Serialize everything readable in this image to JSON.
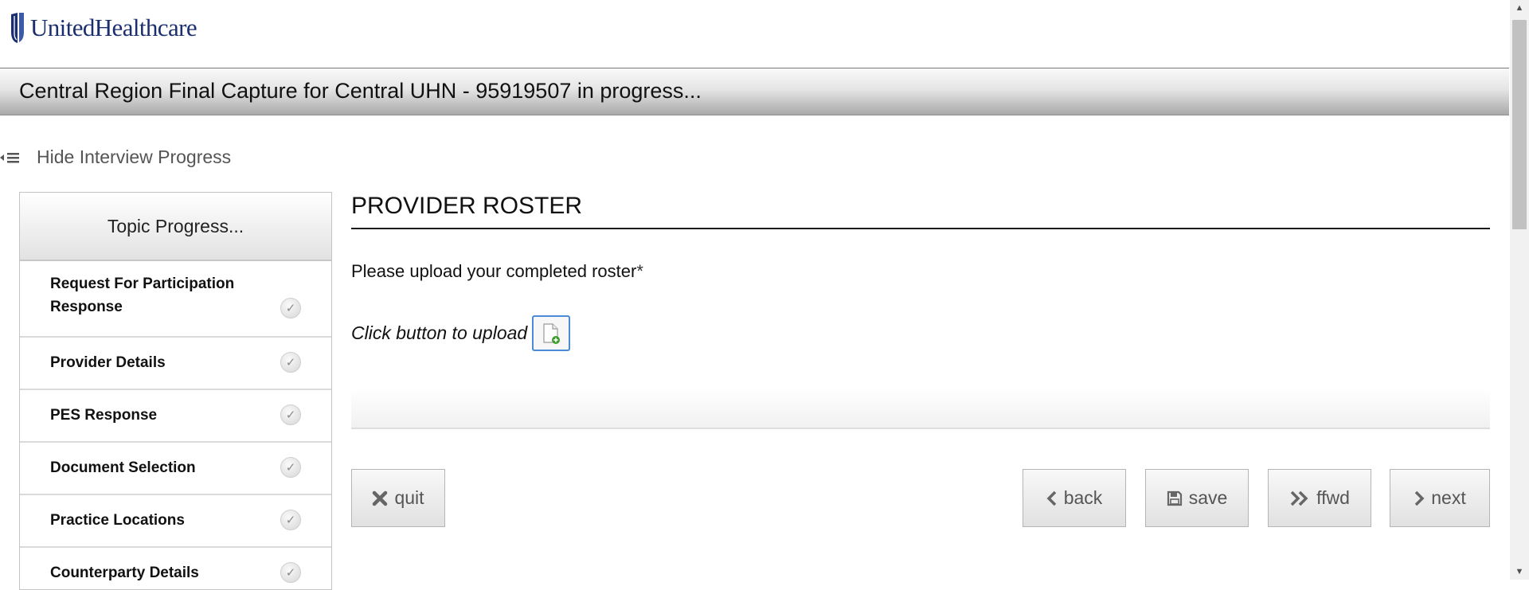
{
  "brand": {
    "name": "UnitedHealthcare"
  },
  "header": {
    "title": "Central Region Final Capture for Central UHN - 95919507 in progress..."
  },
  "progress_toggle": {
    "label": "Hide Interview Progress",
    "icon": "list-collapse-icon"
  },
  "sidebar": {
    "heading": "Topic Progress...",
    "items": [
      {
        "label": "Request For Participation Response",
        "status": "complete"
      },
      {
        "label": "Provider Details",
        "status": "complete"
      },
      {
        "label": "PES Response",
        "status": "complete"
      },
      {
        "label": "Document Selection",
        "status": "complete"
      },
      {
        "label": "Practice Locations",
        "status": "complete"
      },
      {
        "label": "Counterparty Details",
        "status": "complete"
      }
    ]
  },
  "main": {
    "section_title": "PROVIDER ROSTER",
    "question": "Please upload your completed roster",
    "required_marker": "*",
    "upload_label": "Click button to upload",
    "upload_icon": "file-add-icon"
  },
  "buttons": {
    "quit": "quit",
    "back": "back",
    "save": "save",
    "ffwd": "ffwd",
    "next": "next"
  },
  "colors": {
    "brand_blue": "#1b2f6e",
    "upload_border": "#4a8ad6",
    "check_gray": "#8a8a8a"
  }
}
